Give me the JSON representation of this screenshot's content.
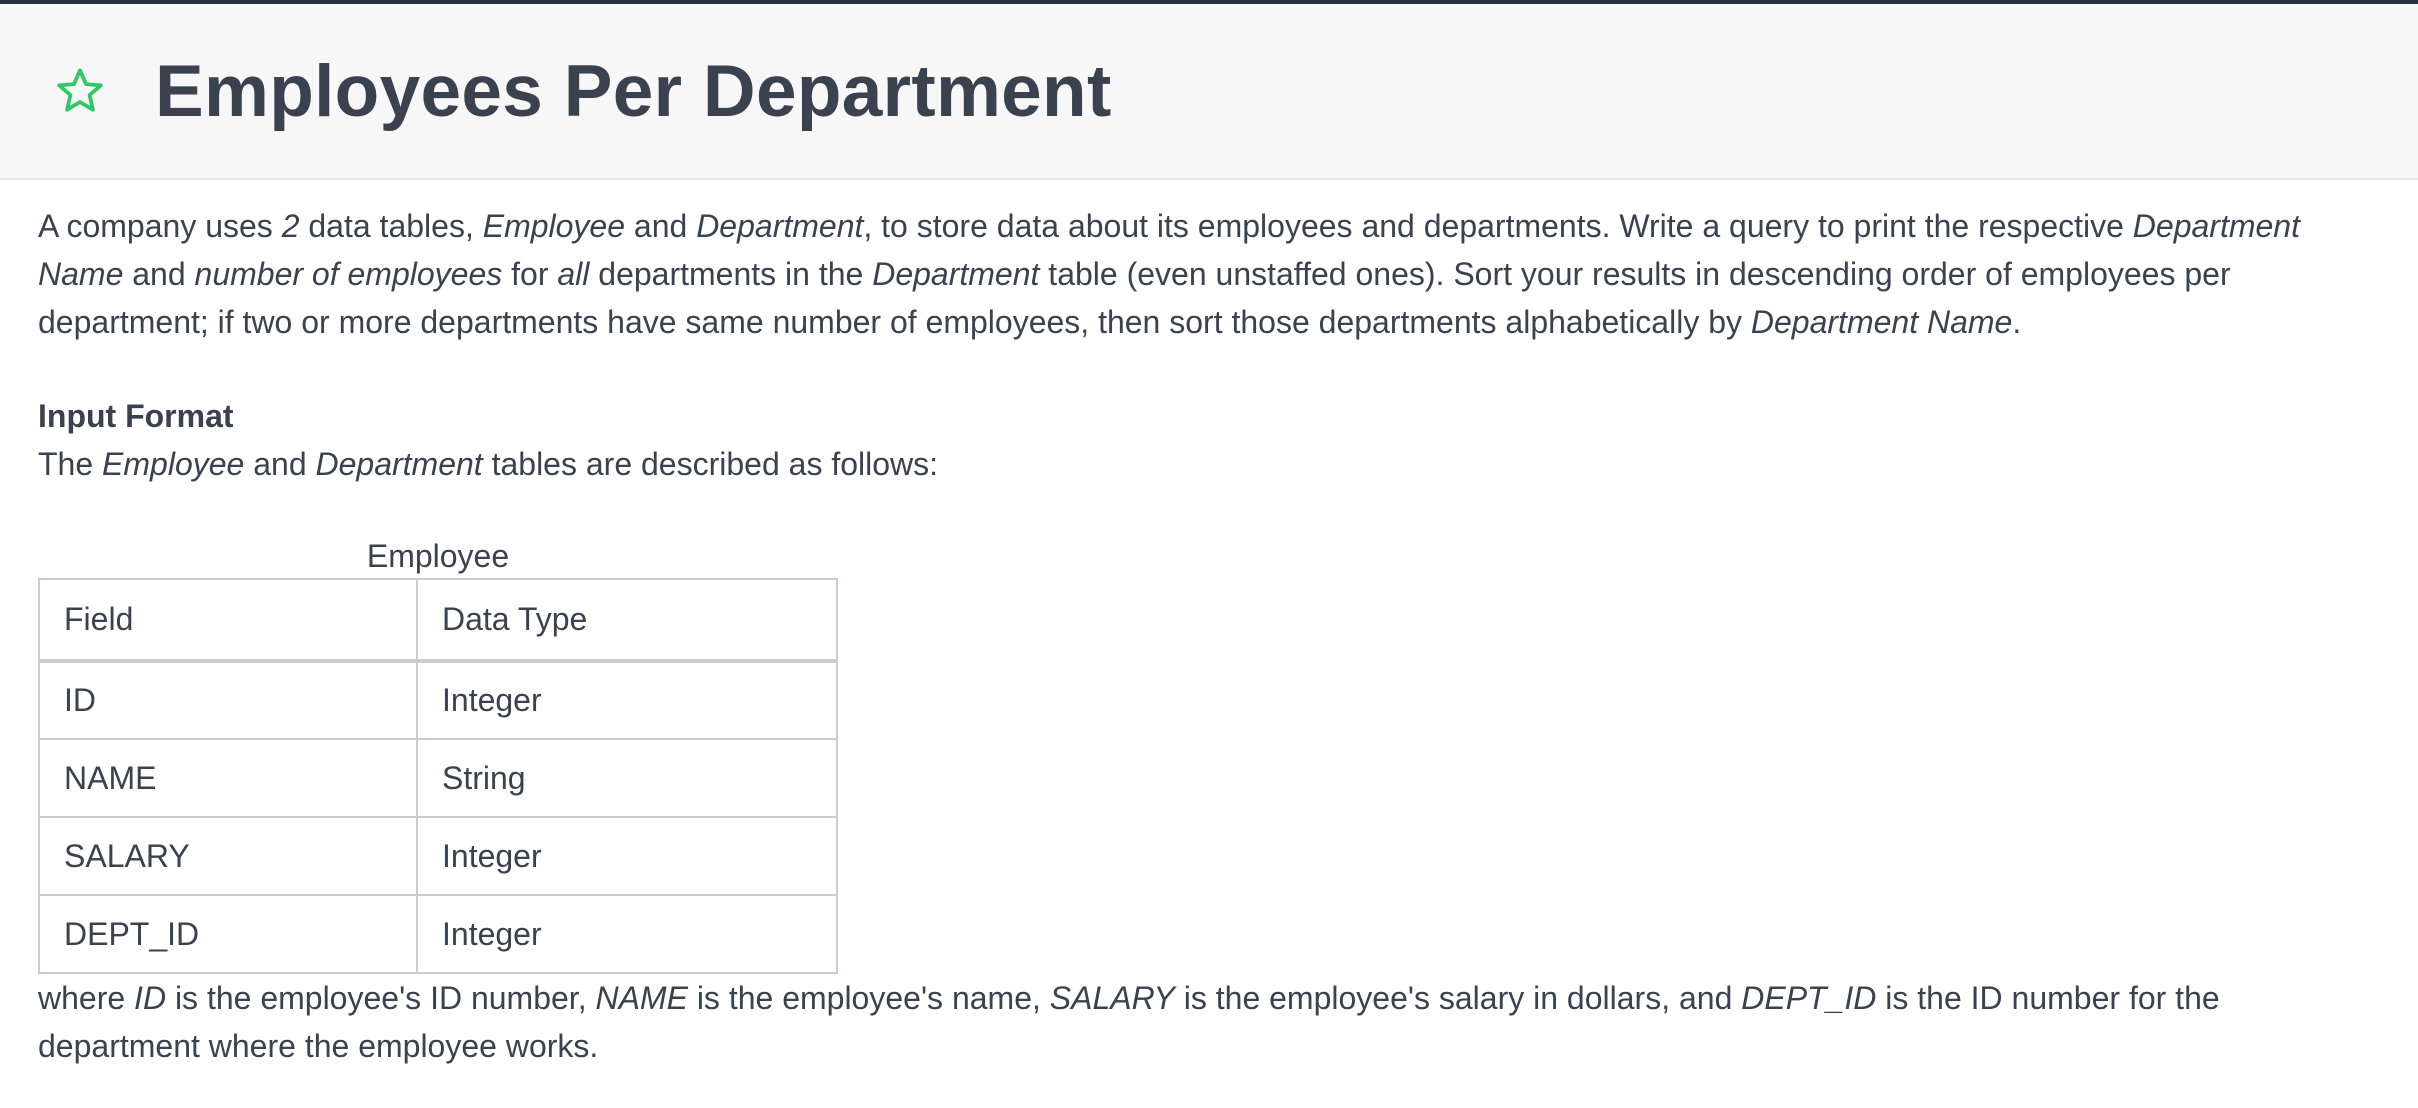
{
  "header": {
    "title": "Employees Per Department",
    "star_icon": "star-outline-icon",
    "star_color": "#2ec866",
    "top_rule_color": "#243040"
  },
  "intro": {
    "p1": "A company uses ",
    "p2": "2",
    "p3": " data tables, ",
    "p4": "Employee",
    "p5": " and ",
    "p6": "Department",
    "p7": ", to store data about its employees and departments. Write a query to print the respective ",
    "p8": "Department Name",
    "p9": " and ",
    "p10": "number of employees",
    "p11": " for ",
    "p12": "all",
    "p13": " departments in the ",
    "p14": "Department",
    "p15": " table (even unstaffed ones). Sort your results in descending order of employees per department; if two or more departments have same number of employees, then sort those departments alphabetically by ",
    "p16": "Department Name",
    "p17": "."
  },
  "input_format": {
    "heading": "Input Format",
    "t1": "The ",
    "t2": "Employee",
    "t3": " and ",
    "t4": "Department",
    "t5": " tables are described as follows:"
  },
  "employee_table": {
    "caption": "Employee",
    "headers": [
      "Field",
      "Data Type"
    ],
    "rows": [
      [
        "ID",
        "Integer"
      ],
      [
        "NAME",
        "String"
      ],
      [
        "SALARY",
        "Integer"
      ],
      [
        "DEPT_ID",
        "Integer"
      ]
    ]
  },
  "note": {
    "n1": "where ",
    "n2": "ID",
    "n3": " is the employee's ID number, ",
    "n4": "NAME",
    "n5": " is the employee's name, ",
    "n6": "SALARY",
    "n7": " is the employee's salary in dollars, and ",
    "n8": "DEPT_ID",
    "n9": " is the ID number for the department where the employee works."
  }
}
